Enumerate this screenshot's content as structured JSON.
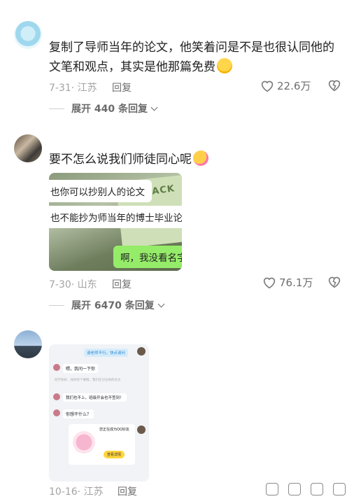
{
  "comments": [
    {
      "text": "复制了导师当年的论文，他笑着问是不是也很认同他的文笔和观点，其实是他那篇免费",
      "emoji": "grinning-face-emoji",
      "date_location": "7-31· 江苏",
      "reply_label": "回复",
      "likes": "22.6万",
      "expand_label": "展开 440 条回复"
    },
    {
      "text": "要不怎么说我们师徒同心呢",
      "emoji": "hugging-face-emoji",
      "image": {
        "bubble_1": "也你可以抄别人的论文",
        "bubble_2": "也不能抄为师当年的博士毕业论文",
        "bubble_3": "啊，我没看名字",
        "box_text": "PACK"
      },
      "date_location": "7-30· 山东",
      "reply_label": "回复",
      "likes": "76.1万",
      "expand_label": "展开 6470 条回复"
    },
    {
      "image": {
        "top_banner": "请老师不行，快点请问",
        "msg_1": "喂，我问一下你",
        "msg_2": "同学你好，找你有个事情，我们在讨论你的论文",
        "msg_3": "我们也不上，班级开会也不签到！",
        "msg_4": "你想干什么？",
        "card_title": "您正在成为QQ好友",
        "card_button": "查看详情"
      },
      "date_location": "10-16· 江苏",
      "reply_label": "回复"
    }
  ],
  "icons": {
    "heart": "heart-outline-icon",
    "dislike": "broken-heart-icon",
    "bottom_toolbar": [
      "icon-button-1",
      "icon-button-2",
      "icon-button-3",
      "icon-button-4"
    ]
  },
  "colors": {
    "accent_green": "#95ec69",
    "text_gray": "#a3a3a3"
  }
}
